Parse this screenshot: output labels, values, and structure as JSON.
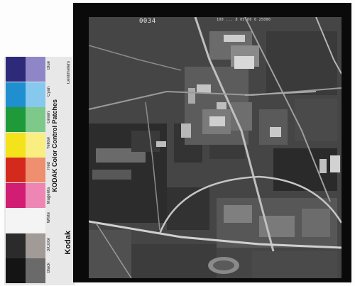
{
  "frame": {
    "number": "0034",
    "meta": "100 ... 8 05.06 6 25000"
  },
  "kodak_strip": {
    "title": "KODAK Color Control Patches",
    "brand": "Kodak",
    "ruler_label": "Centimeters",
    "patches": [
      {
        "name": "Blue",
        "color_dark": "#2e2a7a",
        "color_light": "#8f86c8"
      },
      {
        "name": "Cyan",
        "color_dark": "#1f8fd0",
        "color_light": "#86c8ee"
      },
      {
        "name": "Green",
        "color_dark": "#1e9a3a",
        "color_light": "#7cc98a"
      },
      {
        "name": "Yellow",
        "color_dark": "#f4e21a",
        "color_light": "#f8ef80"
      },
      {
        "name": "Red",
        "color_dark": "#d42a1e",
        "color_light": "#ee8f70"
      },
      {
        "name": "Magenta",
        "color_dark": "#d11e74",
        "color_light": "#ee86b4"
      },
      {
        "name": "White",
        "color_dark": "#f4f4f4",
        "color_light": "#f4f4f4"
      },
      {
        "name": "3/Color",
        "color_dark": "#2b2b2b",
        "color_light": "#a19a97"
      },
      {
        "name": "Black",
        "color_dark": "#141414",
        "color_light": "#6a6a6a"
      }
    ]
  }
}
